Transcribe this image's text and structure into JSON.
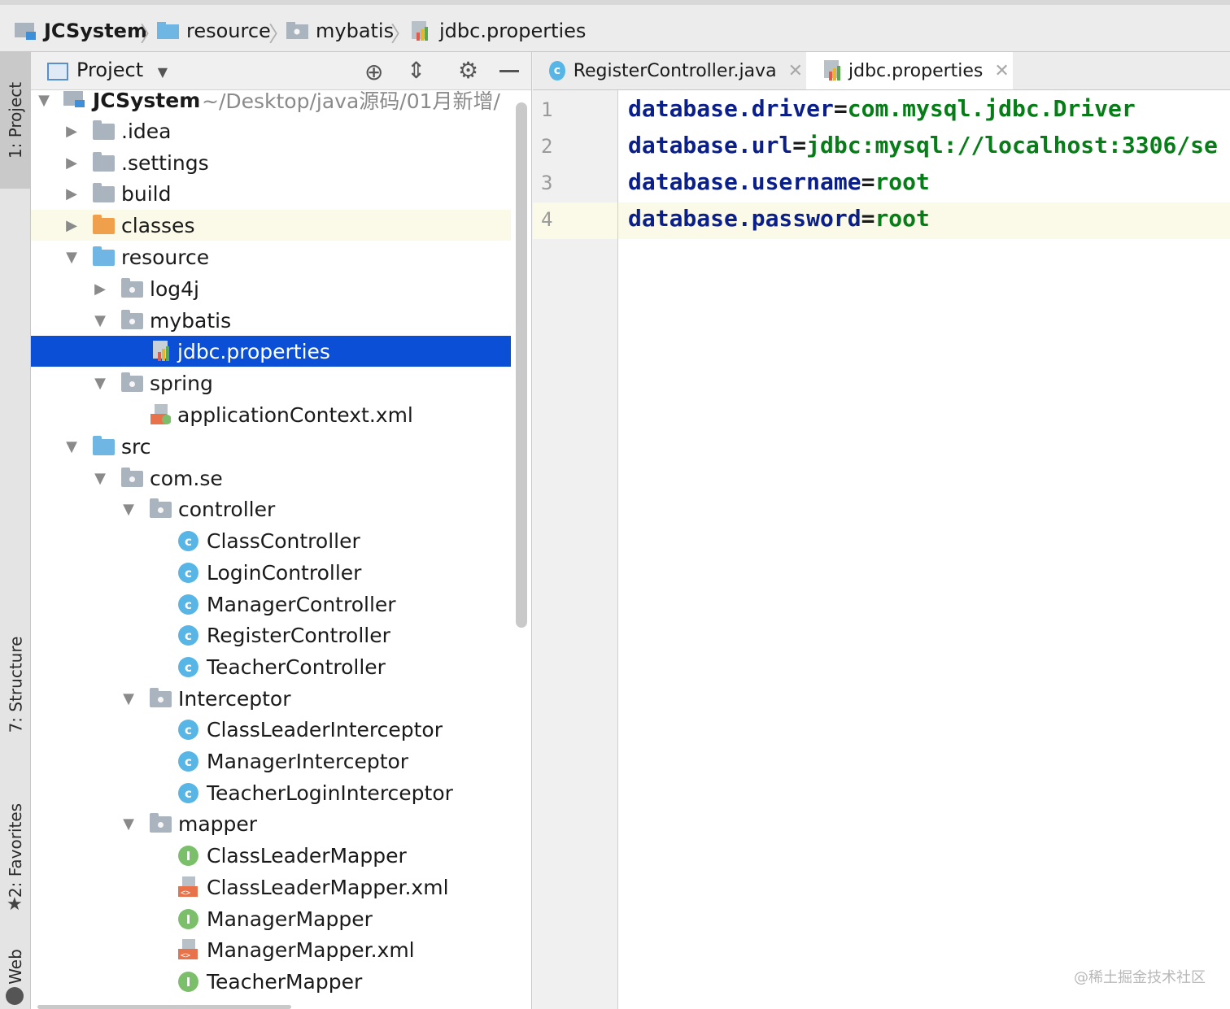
{
  "breadcrumb": {
    "items": [
      "JCSystem",
      "resource",
      "mybatis",
      "jdbc.properties"
    ]
  },
  "left_stripe": {
    "project_tab": "1: Project",
    "structure_tab": "7: Structure",
    "favorites_tab": "2: Favorites",
    "web_tab": "Web"
  },
  "project_panel": {
    "view_label": "Project",
    "root_name": "JCSystem",
    "root_path": "~/Desktop/java源码/01月新增/",
    "tree": [
      {
        "label": ".idea"
      },
      {
        "label": ".settings"
      },
      {
        "label": "build"
      },
      {
        "label": "classes"
      },
      {
        "label": "resource"
      },
      {
        "label": "log4j"
      },
      {
        "label": "mybatis"
      },
      {
        "label": "jdbc.properties"
      },
      {
        "label": "spring"
      },
      {
        "label": "applicationContext.xml"
      },
      {
        "label": "src"
      },
      {
        "label": "com.se"
      },
      {
        "label": "controller"
      },
      {
        "label": "ClassController"
      },
      {
        "label": "LoginController"
      },
      {
        "label": "ManagerController"
      },
      {
        "label": "RegisterController"
      },
      {
        "label": "TeacherController"
      },
      {
        "label": "Interceptor"
      },
      {
        "label": "ClassLeaderInterceptor"
      },
      {
        "label": "ManagerInterceptor"
      },
      {
        "label": "TeacherLoginInterceptor"
      },
      {
        "label": "mapper"
      },
      {
        "label": "ClassLeaderMapper"
      },
      {
        "label": "ClassLeaderMapper.xml"
      },
      {
        "label": "ManagerMapper"
      },
      {
        "label": "ManagerMapper.xml"
      },
      {
        "label": "TeacherMapper"
      }
    ]
  },
  "editor": {
    "tabs": [
      {
        "label": "RegisterController.java",
        "active": false
      },
      {
        "label": "jdbc.properties",
        "active": true
      }
    ],
    "lines": [
      {
        "num": "1",
        "key": "database.driver",
        "eq": "=",
        "value": "com.mysql.jdbc.Driver"
      },
      {
        "num": "2",
        "key": "database.url",
        "eq": "=",
        "value": "jdbc:mysql://localhost:3306/se"
      },
      {
        "num": "3",
        "key": "database.username",
        "eq": "=",
        "value": "root"
      },
      {
        "num": "4",
        "key": "database.password",
        "eq": "=",
        "value": "root"
      }
    ]
  },
  "watermark": "@稀土掘金技术社区",
  "colors": {
    "selection": "#0b4fd6",
    "highlight_row": "#fbf9e7",
    "property_key": "#0b1f8a",
    "property_value": "#067d17",
    "class_icon": "#57b6e6",
    "interface_icon": "#7cbf6b"
  }
}
